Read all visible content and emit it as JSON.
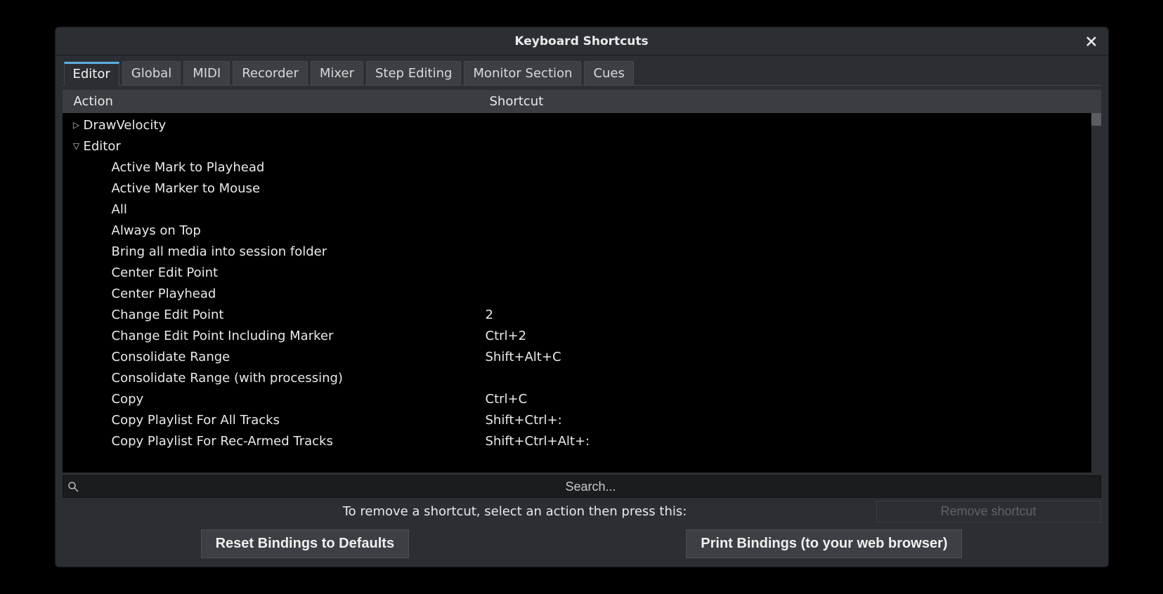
{
  "window": {
    "title": "Keyboard Shortcuts"
  },
  "tabs": [
    {
      "label": "Editor"
    },
    {
      "label": "Global"
    },
    {
      "label": "MIDI"
    },
    {
      "label": "Recorder"
    },
    {
      "label": "Mixer"
    },
    {
      "label": "Step Editing"
    },
    {
      "label": "Monitor Section"
    },
    {
      "label": "Cues"
    }
  ],
  "columns": {
    "action": "Action",
    "shortcut": "Shortcut"
  },
  "tree": [
    {
      "expanded": false,
      "depth": 0,
      "action": "DrawVelocity",
      "shortcut": ""
    },
    {
      "expanded": true,
      "depth": 0,
      "action": "Editor",
      "shortcut": ""
    },
    {
      "depth": 1,
      "action": "Active Mark to Playhead",
      "shortcut": ""
    },
    {
      "depth": 1,
      "action": "Active Marker to Mouse",
      "shortcut": ""
    },
    {
      "depth": 1,
      "action": "All",
      "shortcut": ""
    },
    {
      "depth": 1,
      "action": "Always on Top",
      "shortcut": ""
    },
    {
      "depth": 1,
      "action": "Bring all media into session folder",
      "shortcut": ""
    },
    {
      "depth": 1,
      "action": "Center Edit Point",
      "shortcut": ""
    },
    {
      "depth": 1,
      "action": "Center Playhead",
      "shortcut": ""
    },
    {
      "depth": 1,
      "action": "Change Edit Point",
      "shortcut": "2"
    },
    {
      "depth": 1,
      "action": "Change Edit Point Including Marker",
      "shortcut": "Ctrl+2"
    },
    {
      "depth": 1,
      "action": "Consolidate Range",
      "shortcut": "Shift+Alt+C"
    },
    {
      "depth": 1,
      "action": "Consolidate Range (with processing)",
      "shortcut": ""
    },
    {
      "depth": 1,
      "action": "Copy",
      "shortcut": "Ctrl+C"
    },
    {
      "depth": 1,
      "action": "Copy Playlist For All Tracks",
      "shortcut": "Shift+Ctrl+:"
    },
    {
      "depth": 1,
      "action": "Copy Playlist For Rec-Armed Tracks",
      "shortcut": "Shift+Ctrl+Alt+:"
    }
  ],
  "search": {
    "placeholder": "Search..."
  },
  "remove": {
    "hint": "To remove a shortcut, select an action then press this:",
    "button": "Remove shortcut"
  },
  "buttons": {
    "reset": "Reset Bindings to Defaults",
    "print": "Print Bindings (to your web browser)"
  }
}
